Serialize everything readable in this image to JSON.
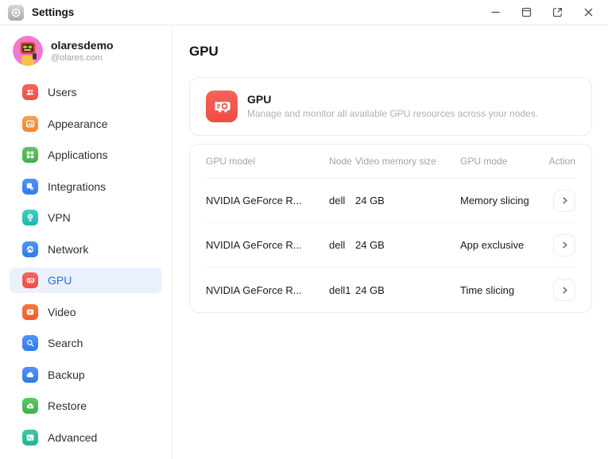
{
  "window": {
    "title": "Settings",
    "controls": {
      "minimize": "minimize",
      "maximize": "maximize",
      "open_external": "open-in-new-window",
      "close": "close"
    }
  },
  "profile": {
    "name": "olaresdemo",
    "handle": "@olares.com"
  },
  "sidebar": {
    "items": [
      {
        "label": "Users",
        "icon": "users-icon",
        "color": "#ee4e44",
        "selected": false
      },
      {
        "label": "Appearance",
        "icon": "appearance-icon",
        "color": "#f58232",
        "selected": false
      },
      {
        "label": "Applications",
        "icon": "applications-icon",
        "color": "#43ae4c",
        "selected": false
      },
      {
        "label": "Integrations",
        "icon": "integrations-icon",
        "color": "#2f7bee",
        "selected": false
      },
      {
        "label": "VPN",
        "icon": "vpn-icon",
        "color": "#1cb9ad",
        "selected": false
      },
      {
        "label": "Network",
        "icon": "network-icon",
        "color": "#2f7bee",
        "selected": false
      },
      {
        "label": "GPU",
        "icon": "gpu-icon",
        "color": "#ef4c42",
        "selected": true
      },
      {
        "label": "Video",
        "icon": "video-icon",
        "color": "#f25a2b",
        "selected": false
      },
      {
        "label": "Search",
        "icon": "search-icon",
        "color": "#2f7bee",
        "selected": false
      },
      {
        "label": "Backup",
        "icon": "backup-icon",
        "color": "#2f7bee",
        "selected": false
      },
      {
        "label": "Restore",
        "icon": "restore-icon",
        "color": "#3fb04a",
        "selected": false
      },
      {
        "label": "Advanced",
        "icon": "advanced-icon",
        "color": "#1fb494",
        "selected": false
      }
    ]
  },
  "main": {
    "page_title": "GPU",
    "info_card": {
      "title": "GPU",
      "description": "Manage and monitor all available GPU resources across your nodes.",
      "icon": "gpu-icon",
      "icon_color": "#ef4c42"
    },
    "table": {
      "headers": {
        "model": "GPU model",
        "node": "Node",
        "memory": "Video memory size",
        "mode": "GPU mode",
        "action": "Action"
      },
      "rows": [
        {
          "model": "NVIDIA GeForce R...",
          "node": "dell",
          "memory": "24 GB",
          "mode": "Memory slicing"
        },
        {
          "model": "NVIDIA GeForce R...",
          "node": "dell",
          "memory": "24 GB",
          "mode": "App exclusive"
        },
        {
          "model": "NVIDIA GeForce R...",
          "node": "dell1",
          "memory": "24 GB",
          "mode": "Time slicing"
        }
      ]
    }
  },
  "colors": {
    "selected_bg": "#eaf1fd",
    "selected_text": "#2b6cea",
    "muted_text": "#9ca3af",
    "border": "#ececec"
  }
}
